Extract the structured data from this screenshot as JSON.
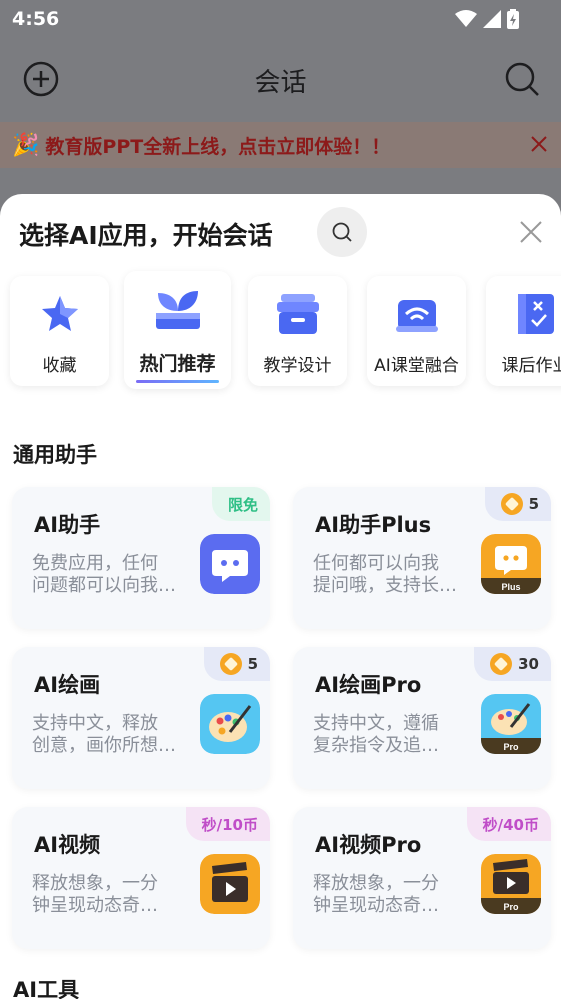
{
  "status": {
    "time": "4:56"
  },
  "appbar": {
    "title": "会话"
  },
  "banner": {
    "text": "教育版PPT全新上线，点击立即体验！！"
  },
  "sheet": {
    "title": "选择AI应用，开始会话",
    "categories": [
      {
        "label": "收藏",
        "icon": "star-icon"
      },
      {
        "label": "热门推荐",
        "icon": "sprout-icon",
        "active": true
      },
      {
        "label": "教学设计",
        "icon": "archive-box-icon"
      },
      {
        "label": "AI课堂融合",
        "icon": "classroom-wifi-icon"
      },
      {
        "label": "课后作业",
        "icon": "homework-book-icon"
      }
    ],
    "section_general": "通用助手",
    "section_tools": "AI工具",
    "cards": [
      {
        "name": "AI助手",
        "desc1": "免费应用，任何",
        "desc2": "问题都可以向我…",
        "tag": "限免",
        "tag_type": "free",
        "icon": "chat-bot-icon"
      },
      {
        "name": "AI助手Plus",
        "desc1": "任何都可以向我",
        "desc2": "提问哦，支持长…",
        "tag": "5",
        "tag_type": "coin",
        "icon": "chat-bot-plus-icon",
        "icon_badge": "Plus"
      },
      {
        "name": "AI绘画",
        "desc1": "支持中文，释放",
        "desc2": "创意，画你所想…",
        "tag": "5",
        "tag_type": "coin",
        "icon": "palette-icon"
      },
      {
        "name": "AI绘画Pro",
        "desc1": "支持中文，遵循",
        "desc2": "复杂指令及追…",
        "tag": "30",
        "tag_type": "coin",
        "icon": "palette-pro-icon",
        "icon_badge": "Pro"
      },
      {
        "name": "AI视频",
        "desc1": "释放想象，一分",
        "desc2": "钟呈现动态奇…",
        "tag": "秒/10币",
        "tag_type": "sec",
        "icon": "clapper-icon"
      },
      {
        "name": "AI视频Pro",
        "desc1": "释放想象，一分",
        "desc2": "钟呈现动态奇…",
        "tag": "秒/40币",
        "tag_type": "sec",
        "icon": "clapper-pro-icon",
        "icon_badge": "Pro"
      }
    ]
  },
  "colors": {
    "accent": "#5b6cf0",
    "brand_orange": "#f6a623",
    "free_green": "#2fbf86",
    "sec_purple": "#c04ec8"
  }
}
